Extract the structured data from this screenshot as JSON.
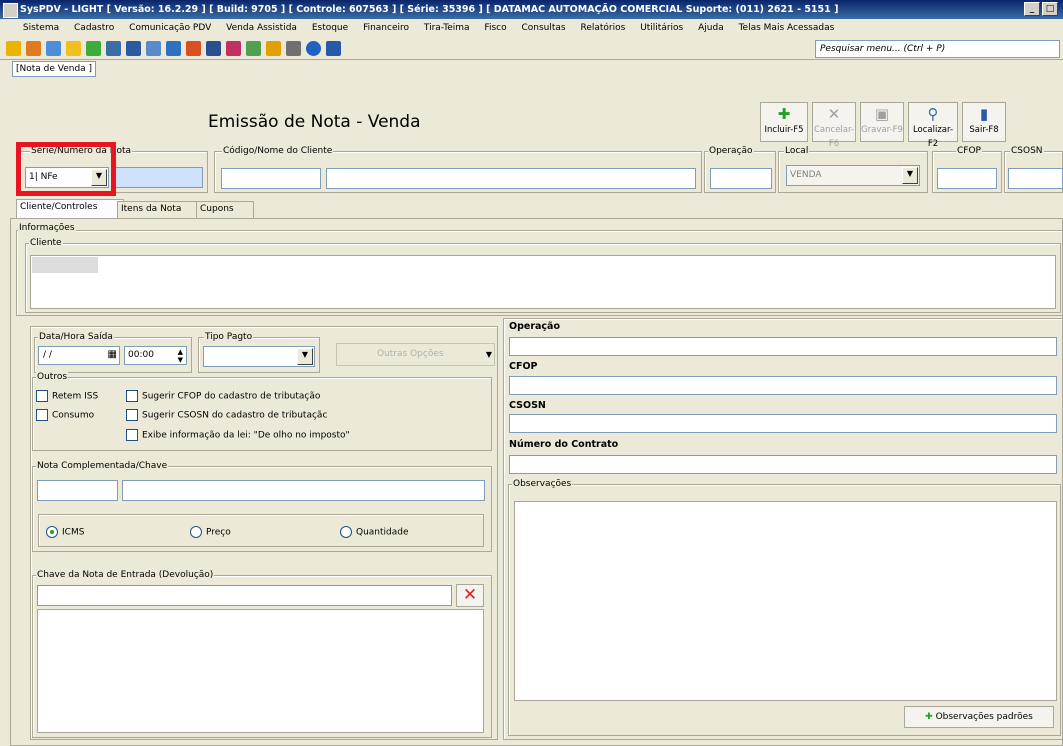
{
  "window": {
    "title": "SysPDV - LIGHT [ Versão: 16.2.29 ] [ Build: 9705 ] [ Controle: 607563 ] [ Série: 35396 ] [ DATAMAC AUTOMAÇÃO COMERCIAL  Suporte: (011) 2621 - 5151 ]"
  },
  "menu": {
    "items": [
      "Sistema",
      "Cadastro",
      "Comunicação PDV",
      "Venda Assistida",
      "Estoque",
      "Financeiro",
      "Tira-Teima",
      "Fisco",
      "Consultas",
      "Relatórios",
      "Utilitários",
      "Ajuda",
      "Telas Mais Acessadas"
    ]
  },
  "search": {
    "placeholder": "Pesquisar menu... (Ctrl + P)"
  },
  "doc_tab": "[Nota de Venda ]",
  "form": {
    "title": "Emissão de Nota - Venda",
    "buttons": {
      "incluir": "Incluir-F5",
      "cancelar": "Cancelar-F6",
      "gravar": "Gravar-F9",
      "localizar": "Localizar-F2",
      "sair": "Sair-F8"
    }
  },
  "header_fields": {
    "serie_label": "Série/Número da Nota",
    "serie_value": "1| NFe",
    "cliente_label": "Código/Nome do Cliente",
    "operacao_label": "Operação",
    "local_label": "Local",
    "local_value": "VENDA",
    "cfop_label": "CFOP",
    "csosn_label": "CSOSN"
  },
  "tabs": [
    "Cliente/Controles",
    "Itens da Nota",
    "Cupons"
  ],
  "informacoes": {
    "label": "Informações",
    "cliente_label": "Cliente"
  },
  "saida": {
    "data_label": "Data/Hora Saída",
    "date_value": "/ /",
    "time_value": "00:00",
    "tipo_pagto_label": "Tipo Pagto",
    "outras_opcoes": "Outras Opções"
  },
  "outros": {
    "label": "Outros",
    "retem_iss": "Retem ISS",
    "consumo": "Consumo",
    "sugerir_cfop": "Sugerir CFOP do cadastro de tributação",
    "sugerir_csosn": "Sugerir CSOSN do cadastro de tributaçãc",
    "exibe_info": "Exibe informação da lei: \"De olho no imposto\""
  },
  "nota_complementada": {
    "label": "Nota Complementada/Chave",
    "options": [
      "ICMS",
      "Preço",
      "Quantidade"
    ],
    "selected": "ICMS"
  },
  "chave_devolucao": {
    "label": "Chave da Nota de Entrada (Devolução)"
  },
  "right_panel": {
    "operacao": "Operação",
    "cfop": "CFOP",
    "csosn": "CSOSN",
    "numero_contrato": "Número do Contrato",
    "observacoes": "Observações",
    "obs_padroes_button": "Observações padrões"
  },
  "colors": {
    "highlight": "#e8141f",
    "titlebar": "#0a246a",
    "accent_green": "#21a121"
  }
}
